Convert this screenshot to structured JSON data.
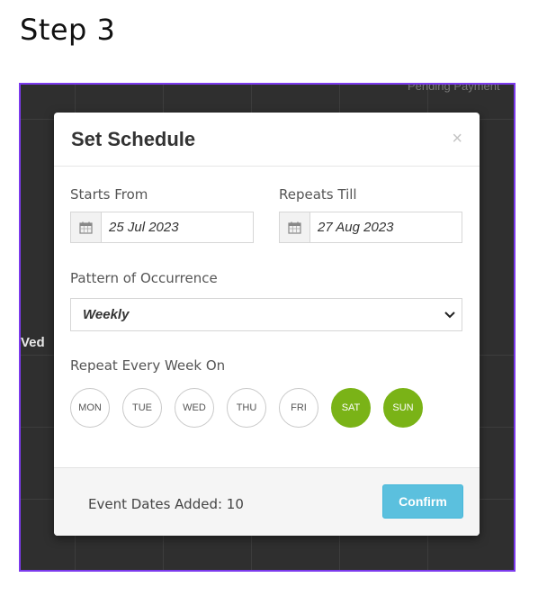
{
  "page": {
    "step_title": "Step 3"
  },
  "background": {
    "left_label": "Ved",
    "top_text": "Pending Payment"
  },
  "modal": {
    "title": "Set Schedule",
    "close_label": "×",
    "starts_from": {
      "label": "Starts From",
      "value": "25 Jul 2023",
      "icon": "calendar-icon"
    },
    "repeats_till": {
      "label": "Repeats Till",
      "value": "27 Aug 2023",
      "icon": "calendar-icon"
    },
    "pattern": {
      "label": "Pattern of Occurrence",
      "value": "Weekly",
      "icon": "chevron-down-icon"
    },
    "repeat_every": {
      "label": "Repeat Every Week On"
    },
    "days": [
      {
        "label": "MON",
        "selected": false
      },
      {
        "label": "TUE",
        "selected": false
      },
      {
        "label": "WED",
        "selected": false
      },
      {
        "label": "THU",
        "selected": false
      },
      {
        "label": "FRI",
        "selected": false
      },
      {
        "label": "SAT",
        "selected": true
      },
      {
        "label": "SUN",
        "selected": true
      }
    ],
    "footer": {
      "event_dates": "Event Dates Added: 10",
      "confirm_label": "Confirm"
    }
  },
  "colors": {
    "accent_border": "#7c3aed",
    "selected_day": "#7ab317",
    "confirm": "#5bc0de"
  }
}
